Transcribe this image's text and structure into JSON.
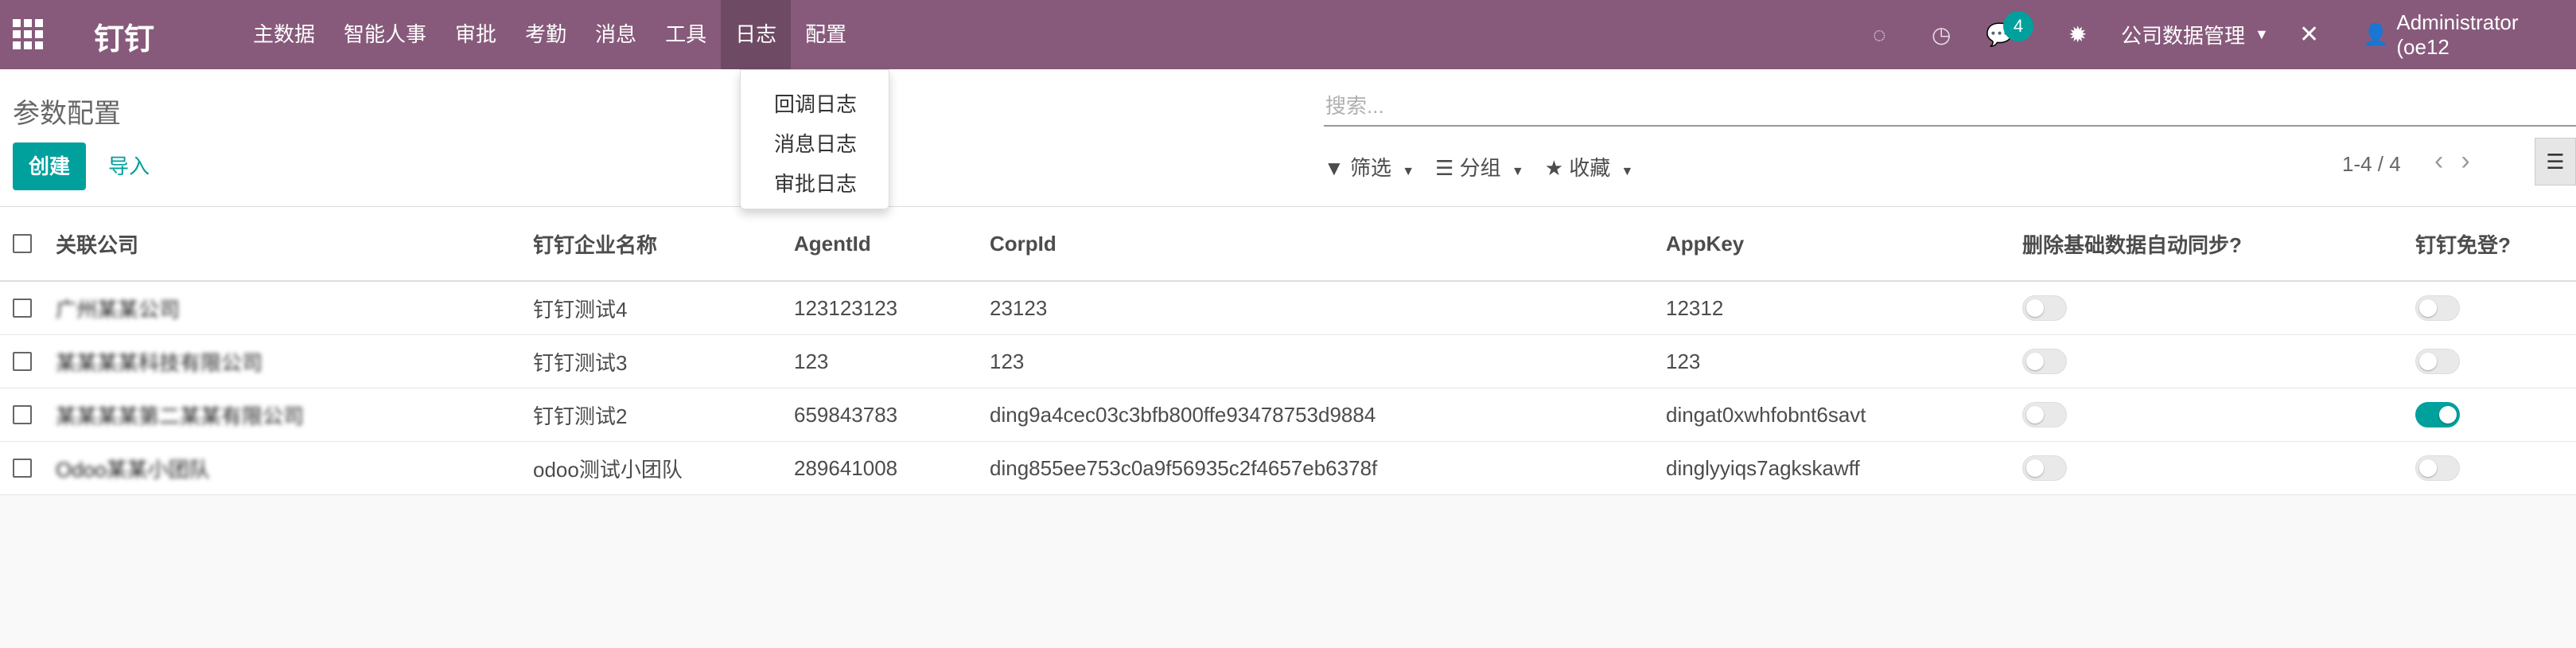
{
  "navbar": {
    "brand": "钉钉",
    "menu": [
      "主数据",
      "智能人事",
      "审批",
      "考勤",
      "消息",
      "工具",
      "日志",
      "配置"
    ],
    "active_menu": "日志",
    "message_count": "4",
    "company": "公司数据管理",
    "user": "Administrator (oe12",
    "icons": [
      "apps-grid-icon",
      "spinner-icon",
      "clock-icon",
      "chat-icon",
      "bug-icon",
      "tools-icon",
      "user-icon"
    ]
  },
  "dropdown": {
    "items": [
      "回调日志",
      "消息日志",
      "审批日志"
    ]
  },
  "control_panel": {
    "title": "参数配置",
    "create_label": "创建",
    "import_label": "导入",
    "search_placeholder": "搜索...",
    "filter_label": "筛选",
    "group_label": "分组",
    "favorite_label": "收藏",
    "pager": "1-4 / 4"
  },
  "table": {
    "columns": [
      "关联公司",
      "钉钉企业名称",
      "AgentId",
      "CorpId",
      "AppKey",
      "删除基础数据自动同步?",
      "钉钉免登?"
    ],
    "rows": [
      {
        "company": "广州某某公司",
        "name": "钉钉测试4",
        "agent_id": "123123123",
        "corp_id": "23123",
        "app_key": "12312",
        "auto_sync": false,
        "sso": false
      },
      {
        "company": "某某某某科技有限公司",
        "name": "钉钉测试3",
        "agent_id": "123",
        "corp_id": "123",
        "app_key": "123",
        "auto_sync": false,
        "sso": false
      },
      {
        "company": "某某某某第二某某有限公司",
        "name": "钉钉测试2",
        "agent_id": "659843783",
        "corp_id": "ding9a4cec03c3bfb800ffe93478753d9884",
        "app_key": "dingat0xwhfobnt6savt",
        "auto_sync": false,
        "sso": true
      },
      {
        "company": "Odoo某某小团队",
        "name": "odoo测试小团队",
        "agent_id": "289641008",
        "corp_id": "ding855ee753c0a9f56935c2f4657eb6378f",
        "app_key": "dinglyyiqs7agkskawff",
        "auto_sync": false,
        "sso": false
      }
    ]
  },
  "colors": {
    "navbar": "#875a7b",
    "accent": "#00a09d"
  }
}
